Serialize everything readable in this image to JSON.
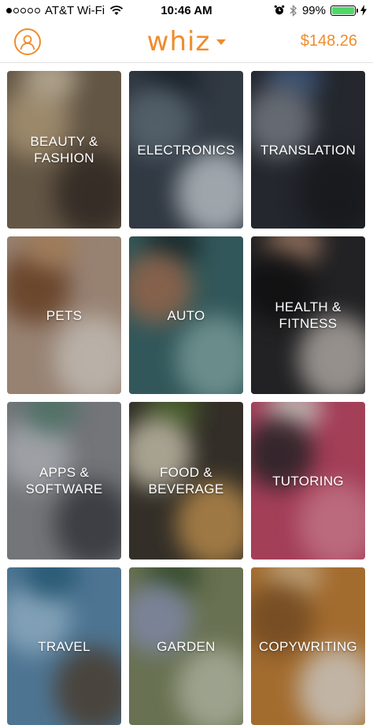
{
  "status_bar": {
    "carrier": "AT&T Wi-Fi",
    "time": "10:46 AM",
    "battery": "99%",
    "battery_level": 0.99,
    "signal_bars_filled": 1,
    "signal_bars_total": 5
  },
  "nav": {
    "logo": "whiz",
    "balance": "$148.26",
    "accent_color": "#f08c2b"
  },
  "categories": [
    {
      "label": "BEAUTY &\nFASHION",
      "name": "beauty-fashion",
      "bg": "#7a6a55",
      "blobs": [
        "#c9b18a",
        "#3a302a",
        "#e2d2b6"
      ]
    },
    {
      "label": "ELECTRONICS",
      "name": "electronics",
      "bg": "#3c4652",
      "blobs": [
        "#d9e2e8",
        "#1f2a33",
        "#6b7b87"
      ]
    },
    {
      "label": "TRANSLATION",
      "name": "translation",
      "bg": "#2c3038",
      "blobs": [
        "#4e6a94",
        "#8a8f98",
        "#1c1e22"
      ]
    },
    {
      "label": "PETS",
      "name": "pets",
      "bg": "#b99f8c",
      "blobs": [
        "#7a4b2a",
        "#e9e1d8",
        "#c4976b"
      ]
    },
    {
      "label": "AUTO",
      "name": "auto",
      "bg": "#3e6b6e",
      "blobs": [
        "#8fb8b6",
        "#1d2f31",
        "#b47a5a"
      ]
    },
    {
      "label": "HEALTH &\nFITNESS",
      "name": "health-fitness",
      "bg": "#2a2a2c",
      "blobs": [
        "#b88f76",
        "#131315",
        "#cfc8c2"
      ]
    },
    {
      "label": "APPS &\nSOFTWARE",
      "name": "apps-software",
      "bg": "#8d8f94",
      "blobs": [
        "#c9cdd3",
        "#3f4248",
        "#5d8a7a"
      ]
    },
    {
      "label": "FOOD &\nBEVERAGE",
      "name": "food-beverage",
      "bg": "#3f3a31",
      "blobs": [
        "#d9a45a",
        "#5d7a3a",
        "#e6dfc8"
      ]
    },
    {
      "label": "TUTORING",
      "name": "tutoring",
      "bg": "#c84d6c",
      "blobs": [
        "#efeae4",
        "#2b2a2d",
        "#e98aa1"
      ]
    },
    {
      "label": "TRAVEL",
      "name": "travel",
      "bg": "#5f8fb3",
      "blobs": [
        "#a9cde6",
        "#5a4a3a",
        "#2e6a8a"
      ]
    },
    {
      "label": "GARDEN",
      "name": "garden",
      "bg": "#7f8a63",
      "blobs": [
        "#cbd1b9",
        "#3f5a34",
        "#9aa4c8"
      ]
    },
    {
      "label": "COPYWRITING",
      "name": "copywriting",
      "bg": "#c7843a",
      "blobs": [
        "#e9c99a",
        "#8a5a2a",
        "#f3ece2"
      ]
    }
  ]
}
